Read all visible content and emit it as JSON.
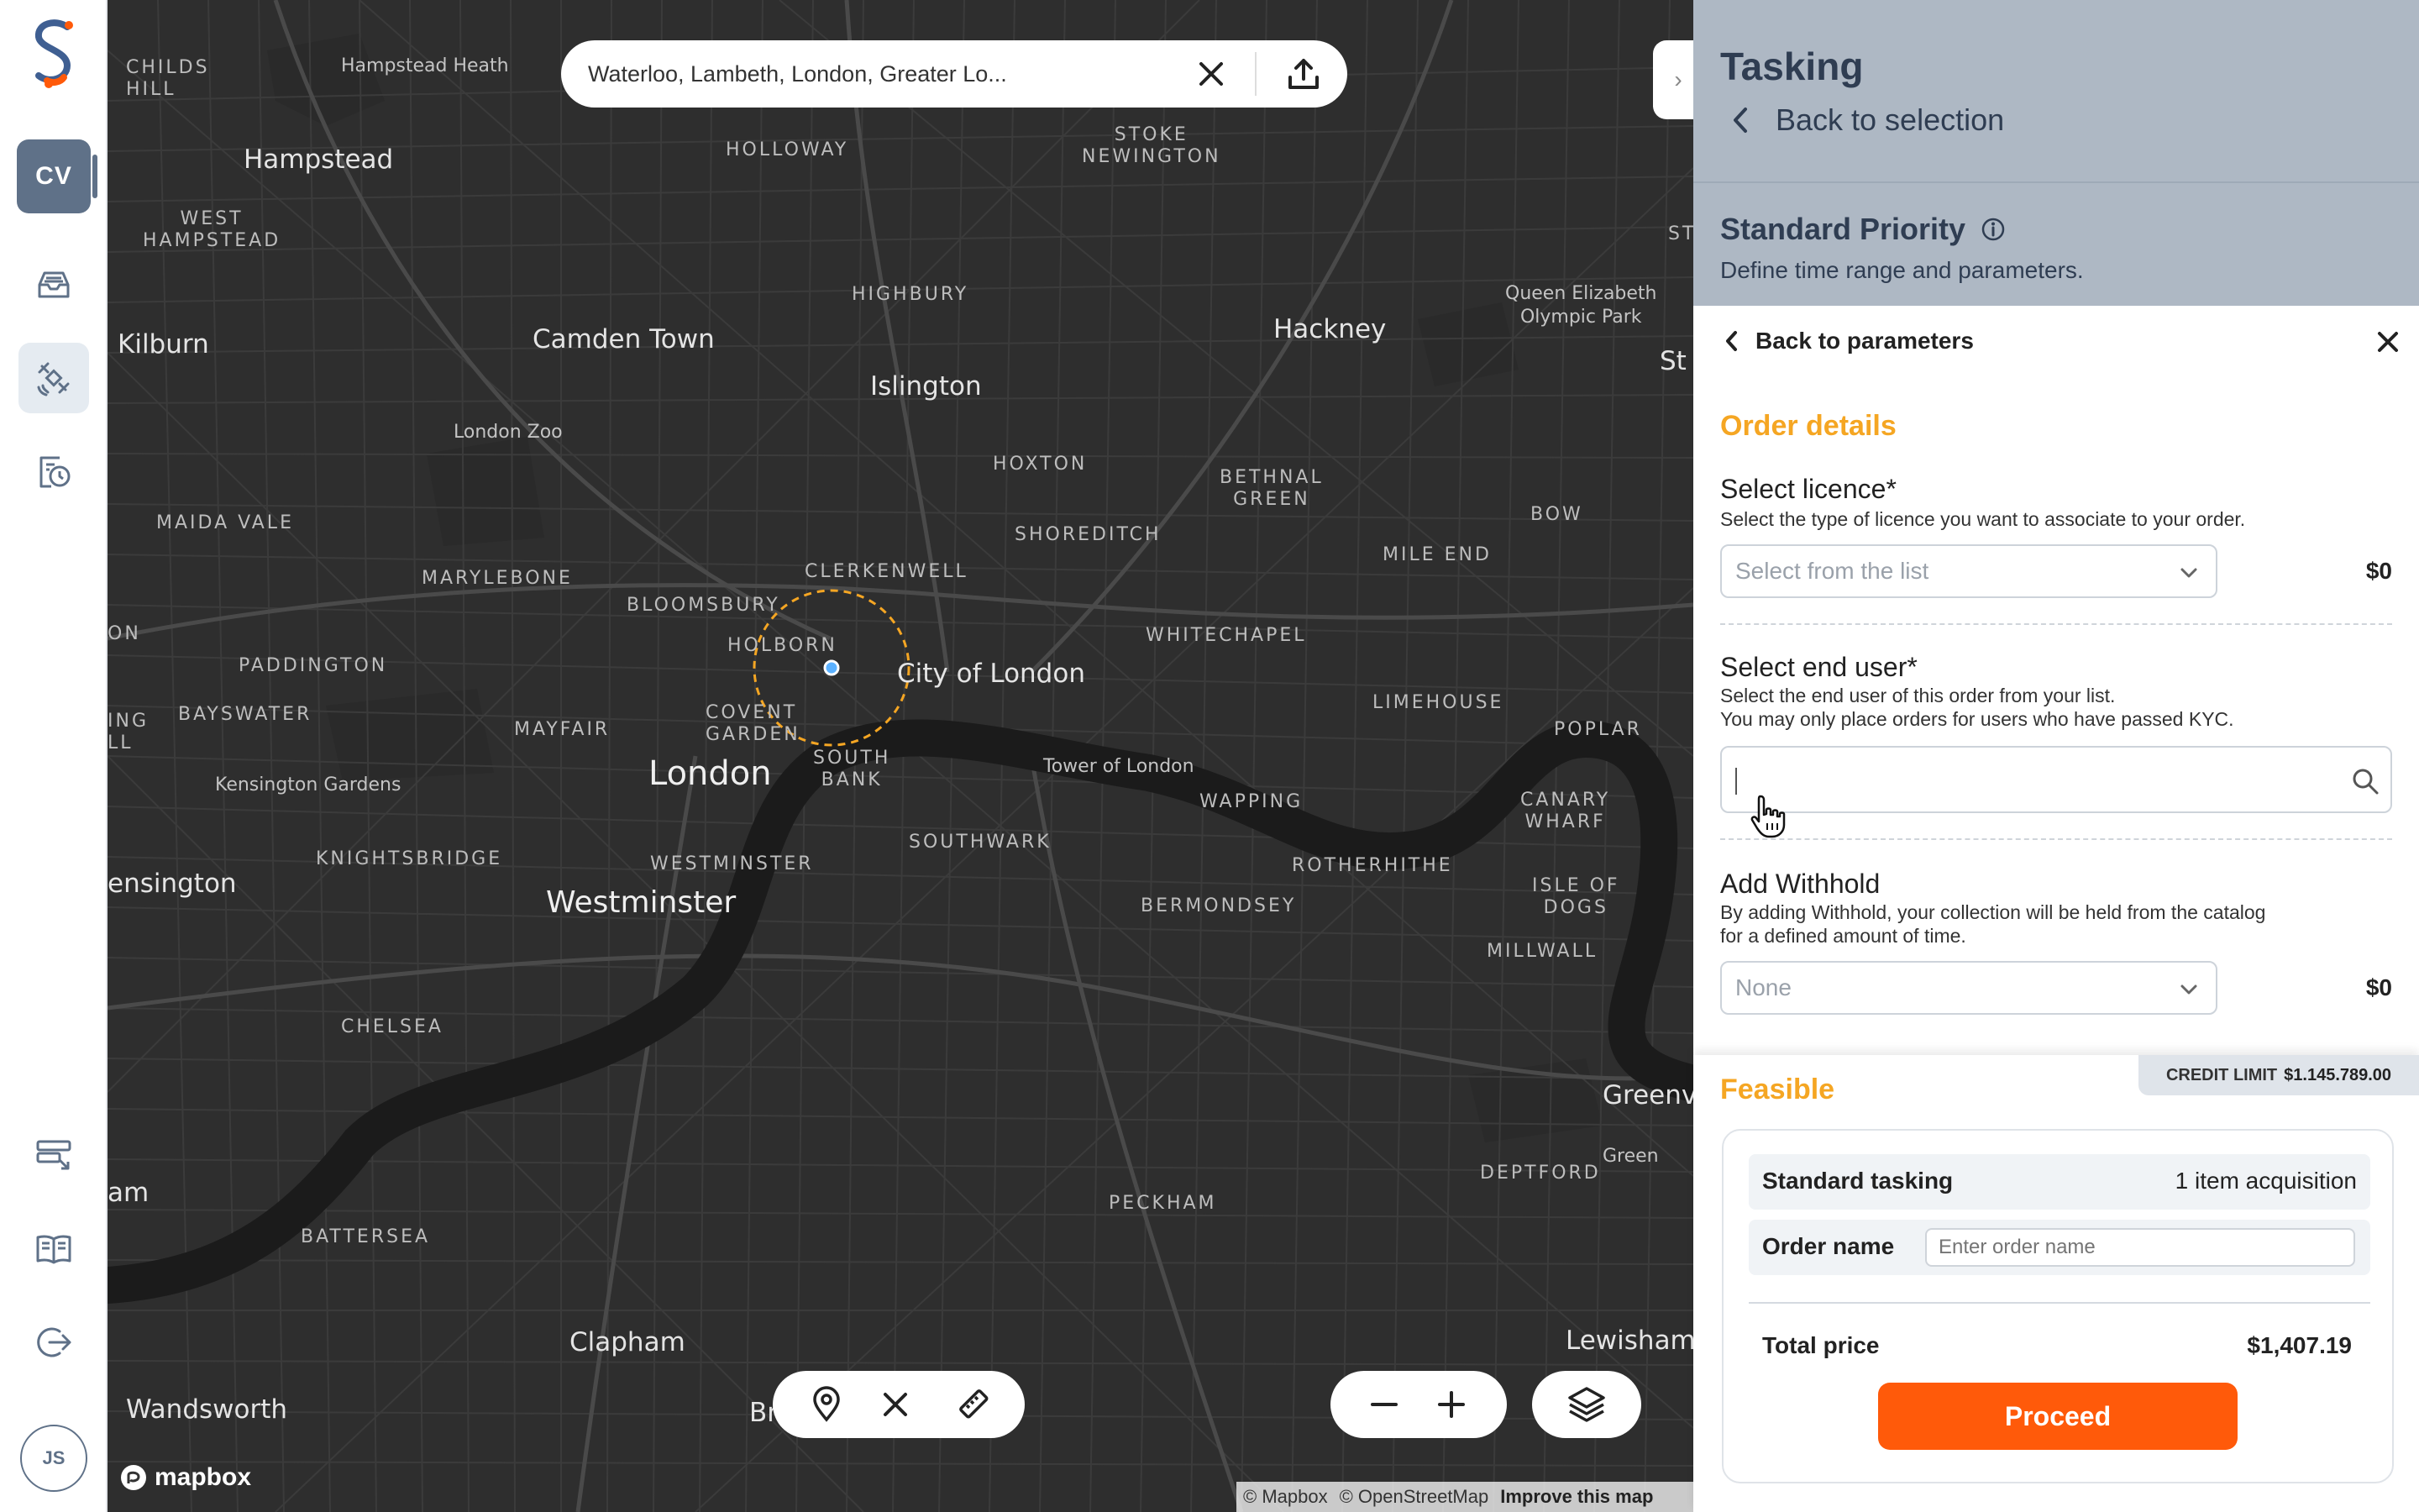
{
  "nav": {
    "workspace_initials": "CV",
    "user_initials": "JS",
    "icons": [
      "inbox-icon",
      "satellite-icon",
      "history-icon",
      "orders-icon",
      "catalog-book-icon",
      "logout-icon"
    ]
  },
  "map": {
    "search_value": "Waterloo, Lambeth, London, Greater Lo...",
    "labels": {
      "hampstead": "Hampstead",
      "childs_hill": "CHILDS\nHILL",
      "hampstead_heath": "Hampstead Heath",
      "west_hampstead": "WEST\nHAMPSTEAD",
      "kilburn": "Kilburn",
      "camden": "Camden Town",
      "holloway": "HOLLOWAY",
      "stoke": "STOKE\nNEWINGTON",
      "highbury": "HIGHBURY",
      "islington": "Islington",
      "hackney": "Hackney",
      "qeop": "Queen Elizabeth\nOlympic Park",
      "st": "St",
      "st2": "ST",
      "london_zoo": "London Zoo",
      "maida_vale": "MAIDA VALE",
      "hoxton": "HOXTON",
      "bethnal": "BETHNAL\nGREEN",
      "bow": "BOW",
      "shoreditch": "SHOREDITCH",
      "marylebone": "MARYLEBONE",
      "clerkenwell": "CLERKENWELL",
      "mile_end": "MILE END",
      "bloomsbury": "BLOOMSBURY",
      "holborn": "HOLBORN",
      "paddington": "PADDINGTON",
      "city": "City of London",
      "whitechapel": "WHITECHAPEL",
      "bayswater": "BAYSWATER",
      "mayfair": "MAYFAIR",
      "covent": "COVENT\nGARDEN",
      "limehouse": "LIMEHOUSE",
      "poplar": "POPLAR",
      "london": "London",
      "south_bank": "SOUTH\nBANK",
      "tower": "Tower of London",
      "kensington_gardens": "Kensington Gardens",
      "wapping": "WAPPING",
      "canary": "CANARY\nWHARF",
      "kensington": "ensington",
      "knightsbridge": "KNIGHTSBRIDGE",
      "westminster_s": "WESTMINSTER",
      "southwark": "SOUTHWARK",
      "rotherhithe": "ROTHERHITHE",
      "isle": "ISLE OF\nDOGS",
      "westminster": "Westminster",
      "bermondsey": "BERMONDSEY",
      "millwall": "MILLWALL",
      "on": "ON",
      "ing": "ING\nLL",
      "chelsea": "CHELSEA",
      "greenwich": "Greenv",
      "greenwich2": "Green",
      "am": "am",
      "battersea": "BATTERSEA",
      "deptford": "DEPTFORD",
      "peckham": "PECKHAM",
      "clapham": "Clapham",
      "lewisham": "Lewisham",
      "wandsworth": "Wandsworth",
      "br": "Br"
    },
    "mapbox_logo": "mapbox",
    "attribution": {
      "mapbox": "© Mapbox",
      "osm": "© OpenStreetMap",
      "improve": "Improve this map"
    }
  },
  "panel": {
    "title": "Tasking",
    "back_selection": "Back to selection",
    "priority_title": "Standard Priority",
    "priority_sub": "Define time range and parameters.",
    "back_parameters": "Back to parameters",
    "order_details": "Order details",
    "licence": {
      "label": "Select licence*",
      "help": "Select the type of licence you want to associate to your order.",
      "placeholder": "Select from the list",
      "price": "$0"
    },
    "end_user": {
      "label": "Select end user*",
      "help1": "Select the end user of this order from your list.",
      "help2": "You may only place orders for users who have passed KYC."
    },
    "withhold": {
      "label": "Add Withhold",
      "help1": "By adding Withhold, your collection will be held from the catalog",
      "help2": "for a defined amount of time.",
      "value": "None",
      "price": "$0"
    },
    "credit_label": "CREDIT LIMIT",
    "credit_value": "$1.145.789.00",
    "feasible": "Feasible",
    "tasking_label": "Standard tasking",
    "tasking_value": "1 item acquisition",
    "order_name_label": "Order name",
    "order_name_placeholder": "Enter order name",
    "total_label": "Total price",
    "total_value": "$1,407.19",
    "proceed": "Proceed"
  },
  "colors": {
    "accent_orange": "#ff5a0a",
    "section_yellow": "#f5a623",
    "header_slate": "#aeb8c4",
    "nav_slate": "#5f7188"
  }
}
